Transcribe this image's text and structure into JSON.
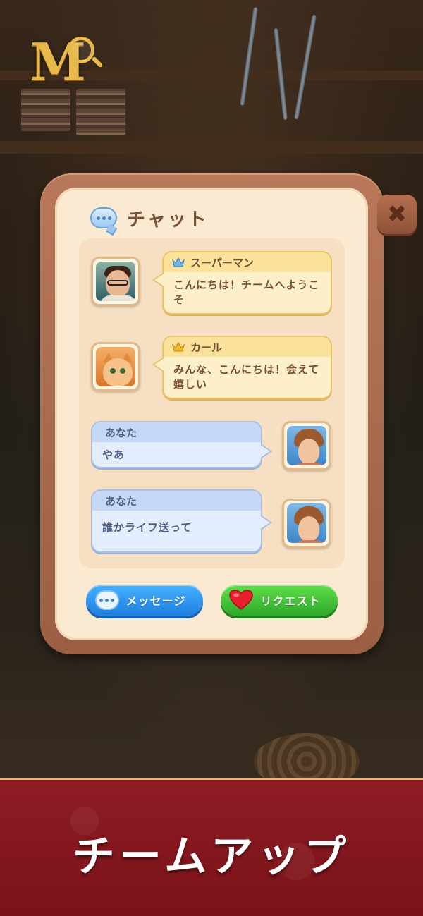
{
  "logo": {
    "letter": "M"
  },
  "chat": {
    "title": "チャット",
    "messages": [
      {
        "sender": "スーパーマン",
        "text": "こんにちは！チームへようこそ",
        "avatar": "man-with-glasses",
        "crown_color": "#6fb0e8"
      },
      {
        "sender": "カール",
        "text": "みんな、こんにちは！会えて嬉しい",
        "avatar": "orange-cat",
        "crown_color": "#f0b62a"
      },
      {
        "sender": "あなた",
        "text": "やあ",
        "avatar": "woman-player"
      },
      {
        "sender": "あなた",
        "text": "誰かライフ送って",
        "avatar": "woman-player"
      }
    ],
    "message_button": "メッセージ",
    "request_button": "リクエスト",
    "close_symbol": "✖"
  },
  "banner": {
    "title": "チームアップ"
  },
  "colors": {
    "panel_frame": "#a9694d",
    "panel_fill": "#fbead2",
    "blue_button": "#1d7fe0",
    "green_button": "#2ea92a",
    "banner_red": "#8e1c24"
  }
}
